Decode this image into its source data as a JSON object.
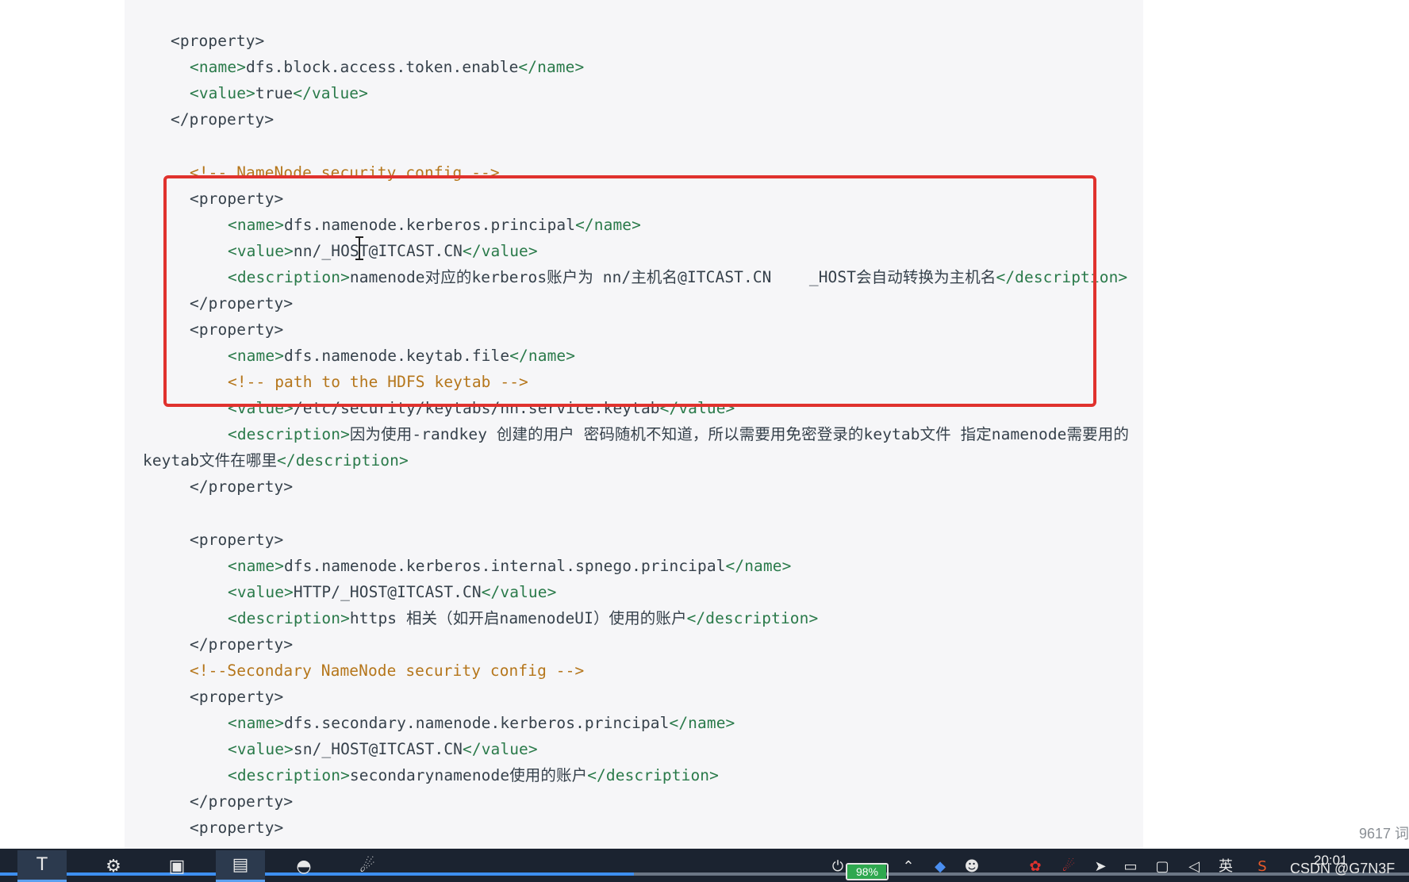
{
  "code_lines": [
    {
      "parts": [
        {
          "t": "<property>",
          "c": "tag-inner"
        }
      ]
    },
    {
      "parts": [
        {
          "t": "<name>",
          "c": "tag"
        },
        {
          "t": "dfs.block.access.token.enable",
          "c": "txt"
        },
        {
          "t": "</name>",
          "c": "tag"
        }
      ]
    },
    {
      "parts": [
        {
          "t": "<value>",
          "c": "tag"
        },
        {
          "t": "true",
          "c": "txt"
        },
        {
          "t": "</value>",
          "c": "tag"
        }
      ]
    },
    {
      "parts": [
        {
          "t": "</property>",
          "c": "tag-inner"
        }
      ]
    },
    {
      "parts": [
        {
          "t": "<!-- NameNode security config -->",
          "c": "comment"
        }
      ]
    },
    {
      "parts": [
        {
          "t": "<property>",
          "c": "tag-inner"
        }
      ]
    },
    {
      "parts": [
        {
          "t": "<name>",
          "c": "tag"
        },
        {
          "t": "dfs.namenode.kerberos.principal",
          "c": "txt"
        },
        {
          "t": "</name>",
          "c": "tag"
        }
      ]
    },
    {
      "parts": [
        {
          "t": "<value>",
          "c": "tag"
        },
        {
          "t": "nn/_HOST@ITCAST.CN",
          "c": "txt"
        },
        {
          "t": "</value>",
          "c": "tag"
        }
      ]
    },
    {
      "parts": [
        {
          "t": "<description>",
          "c": "tag"
        },
        {
          "t": "namenode对应的kerberos账户为 nn/主机名@ITCAST.CN    _HOST会自动转换为主机名",
          "c": "txt"
        },
        {
          "t": "</description>",
          "c": "tag"
        }
      ]
    },
    {
      "parts": [
        {
          "t": "</property>",
          "c": "tag-inner"
        }
      ]
    },
    {
      "parts": [
        {
          "t": "<property>",
          "c": "tag-inner"
        }
      ]
    },
    {
      "parts": [
        {
          "t": "<name>",
          "c": "tag"
        },
        {
          "t": "dfs.namenode.keytab.file",
          "c": "txt"
        },
        {
          "t": "</name>",
          "c": "tag"
        }
      ]
    },
    {
      "parts": [
        {
          "t": "<!-- path to the HDFS keytab -->",
          "c": "comment"
        }
      ]
    },
    {
      "parts": [
        {
          "t": "<value>",
          "c": "tag"
        },
        {
          "t": "/etc/security/keytabs/nn.service.keytab",
          "c": "txt"
        },
        {
          "t": "</value>",
          "c": "tag"
        }
      ]
    },
    {
      "parts": [
        {
          "t": "<description>",
          "c": "tag"
        },
        {
          "t": "因为使用-randkey 创建的用户 密码随机不知道，所以需要用免密登录的keytab文件 指定namenode需要用的",
          "c": "txt"
        }
      ]
    },
    {
      "parts": [
        {
          "t": "keytab文件在哪里",
          "c": "txt"
        },
        {
          "t": "</description>",
          "c": "tag"
        }
      ]
    },
    {
      "parts": [
        {
          "t": "</property>",
          "c": "tag-inner"
        }
      ]
    },
    {
      "parts": [
        {
          "t": "<property>",
          "c": "tag-inner"
        }
      ]
    },
    {
      "parts": [
        {
          "t": "<name>",
          "c": "tag"
        },
        {
          "t": "dfs.namenode.kerberos.internal.spnego.principal",
          "c": "txt"
        },
        {
          "t": "</name>",
          "c": "tag"
        }
      ]
    },
    {
      "parts": [
        {
          "t": "<value>",
          "c": "tag"
        },
        {
          "t": "HTTP/_HOST@ITCAST.CN",
          "c": "txt"
        },
        {
          "t": "</value>",
          "c": "tag"
        }
      ]
    },
    {
      "parts": [
        {
          "t": "<description>",
          "c": "tag"
        },
        {
          "t": "https 相关（如开启namenodeUI）使用的账户",
          "c": "txt"
        },
        {
          "t": "</description>",
          "c": "tag"
        }
      ]
    },
    {
      "parts": [
        {
          "t": "</property>",
          "c": "tag-inner"
        }
      ]
    },
    {
      "parts": [
        {
          "t": "<!--Secondary NameNode security config -->",
          "c": "comment"
        }
      ]
    },
    {
      "parts": [
        {
          "t": "<property>",
          "c": "tag-inner"
        }
      ]
    },
    {
      "parts": [
        {
          "t": "<name>",
          "c": "tag"
        },
        {
          "t": "dfs.secondary.namenode.kerberos.principal",
          "c": "txt"
        },
        {
          "t": "</name>",
          "c": "tag"
        }
      ]
    },
    {
      "parts": [
        {
          "t": "<value>",
          "c": "tag"
        },
        {
          "t": "sn/_HOST@ITCAST.CN",
          "c": "txt"
        },
        {
          "t": "</value>",
          "c": "tag"
        }
      ]
    },
    {
      "parts": [
        {
          "t": "<description>",
          "c": "tag"
        },
        {
          "t": "secondarynamenode使用的账户",
          "c": "txt"
        },
        {
          "t": "</description>",
          "c": "tag"
        }
      ]
    },
    {
      "parts": [
        {
          "t": "</property>",
          "c": "tag-inner"
        }
      ]
    },
    {
      "parts": [
        {
          "t": "<property>",
          "c": "tag-inner"
        }
      ]
    }
  ],
  "status": {
    "word_count": "9617 词"
  },
  "taskbar": {
    "apps": [
      {
        "name": "app-t-icon",
        "glyph": "T",
        "active": true
      },
      {
        "name": "settings-gear-icon",
        "glyph": "⚙",
        "active": false
      },
      {
        "name": "app-orange-icon",
        "glyph": "▣",
        "active": false
      },
      {
        "name": "app-window-icon",
        "glyph": "▤",
        "active": true
      },
      {
        "name": "app-bird-icon",
        "glyph": "◓",
        "active": false
      },
      {
        "name": "app-red-icon",
        "glyph": "☄",
        "active": false
      }
    ],
    "battery_text": "98%",
    "battery_level": 0.98,
    "progress_level": 0.45,
    "input_method": "英",
    "clock": "20:01",
    "watermark": "CSDN @G7N3F"
  }
}
